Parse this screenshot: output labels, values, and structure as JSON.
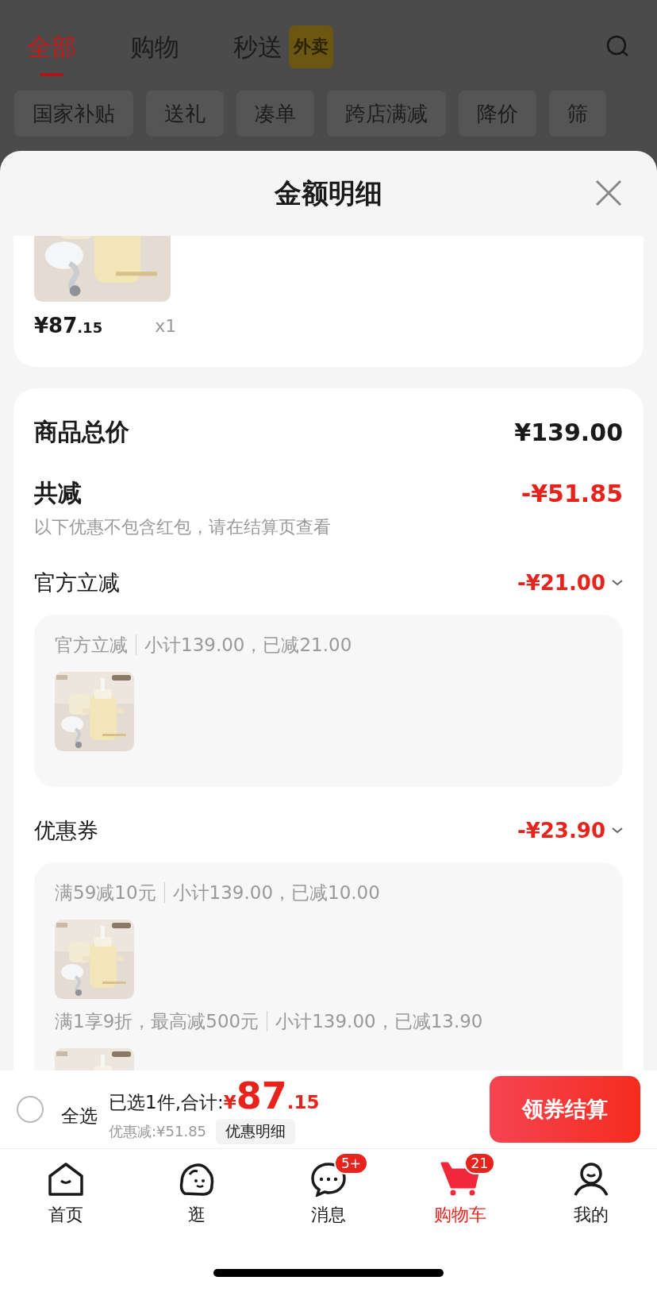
{
  "top_tabs": [
    {
      "label": "全部",
      "selected": true
    },
    {
      "label": "购物",
      "selected": false
    },
    {
      "label": "秒送",
      "selected": false,
      "badge": "外卖"
    }
  ],
  "filter_chips": [
    "国家补贴",
    "送礼",
    "凑单",
    "跨店满减",
    "降价",
    "筛"
  ],
  "sheet": {
    "title": "金额明细",
    "item": {
      "kind": "picture",
      "price_main": "¥87",
      "price_decimal": ".15",
      "quantity": "x1"
    },
    "summary": {
      "total_label": "商品总价",
      "total_value": "¥139.00",
      "reduction_label": "共减",
      "reduction_value": "-¥51.85",
      "note": "以下优惠不包含红包，请在结算页查看"
    },
    "discounts": [
      {
        "label": "官方立减",
        "amount": "-¥21.00",
        "groups": [
          {
            "name": "官方立减",
            "detail": "小计139.00，已减21.00"
          }
        ]
      },
      {
        "label": "优惠券",
        "amount": "-¥23.90",
        "groups": [
          {
            "name": "满59减10元",
            "detail": "小计139.00，已减10.00"
          },
          {
            "name": "满1享9折，最高减500元",
            "detail": "小计139.00，已减13.90"
          }
        ]
      }
    ]
  },
  "checkout_bar": {
    "select_all": {
      "label": "全选",
      "checked": false
    },
    "summary_label": "已选1件,合计:",
    "currency": "¥",
    "total_main": "87",
    "total_decimal": ".15",
    "saving": "优惠减:¥51.85",
    "details_button": "优惠明细",
    "checkout_button": "领券结算"
  },
  "bottom_tabs": [
    {
      "label": "首页",
      "kind": "home",
      "selected": false
    },
    {
      "label": "逛",
      "kind": "explore",
      "selected": false
    },
    {
      "label": "消息",
      "kind": "message",
      "selected": false,
      "badge": "5+"
    },
    {
      "label": "购物车",
      "kind": "cart",
      "selected": true,
      "badge": "21"
    },
    {
      "label": "我的",
      "kind": "profile",
      "selected": false
    }
  ]
}
